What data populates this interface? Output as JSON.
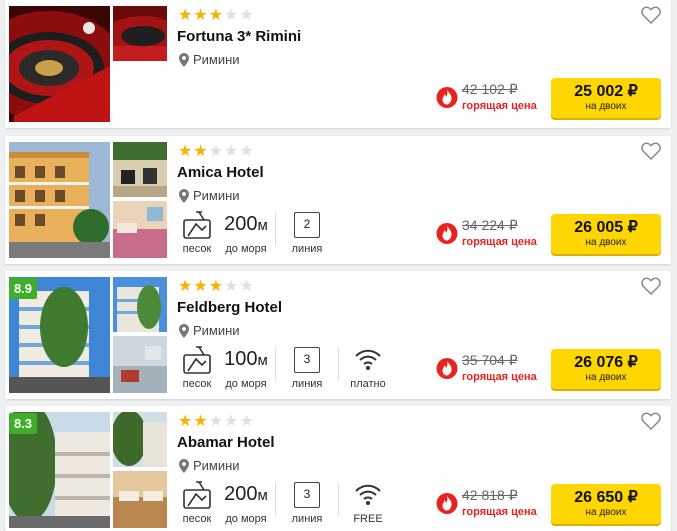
{
  "hotels": [
    {
      "stars": 3,
      "name": "Fortuna 3* Rimini",
      "location": "Римини",
      "rating": "",
      "old_price": "42 102 ₽",
      "hot_label": "горящая цена",
      "price": "25 002 ₽",
      "price_note": "на двоих",
      "amenities": {}
    },
    {
      "stars": 2,
      "name": "Amica Hotel",
      "location": "Римини",
      "rating": "",
      "old_price": "34 224 ₽",
      "hot_label": "горящая цена",
      "price": "26 005 ₽",
      "price_note": "на двоих",
      "amenities": {
        "beach_label": "песок",
        "distance_value": "200",
        "distance_unit": "м",
        "distance_label": "до моря",
        "line_value": "2",
        "line_label": "линия"
      }
    },
    {
      "stars": 3,
      "name": "Feldberg Hotel",
      "location": "Римини",
      "rating": "8.9",
      "old_price": "35 704 ₽",
      "hot_label": "горящая цена",
      "price": "26 076 ₽",
      "price_note": "на двоих",
      "amenities": {
        "beach_label": "песок",
        "distance_value": "100",
        "distance_unit": "м",
        "distance_label": "до моря",
        "line_value": "3",
        "line_label": "линия",
        "wifi_label": "платно"
      }
    },
    {
      "stars": 2,
      "name": "Abamar Hotel",
      "location": "Римини",
      "rating": "8.3",
      "old_price": "42 818 ₽",
      "hot_label": "горящая цена",
      "price": "26 650 ₽",
      "price_note": "на двоих",
      "amenities": {
        "beach_label": "песок",
        "distance_value": "200",
        "distance_unit": "м",
        "distance_label": "до моря",
        "line_value": "3",
        "line_label": "линия",
        "wifi_label": "FREE"
      }
    }
  ],
  "colors": {
    "star_on": "#f5b400",
    "star_off": "#e0e0e0",
    "rating_badge": "#3fae2a",
    "hot_red": "#e8231f",
    "price_button": "#ffd600"
  },
  "icons": [
    "map-pin-icon",
    "heart-icon",
    "flame-icon",
    "beach-sand-icon",
    "wifi-icon"
  ]
}
